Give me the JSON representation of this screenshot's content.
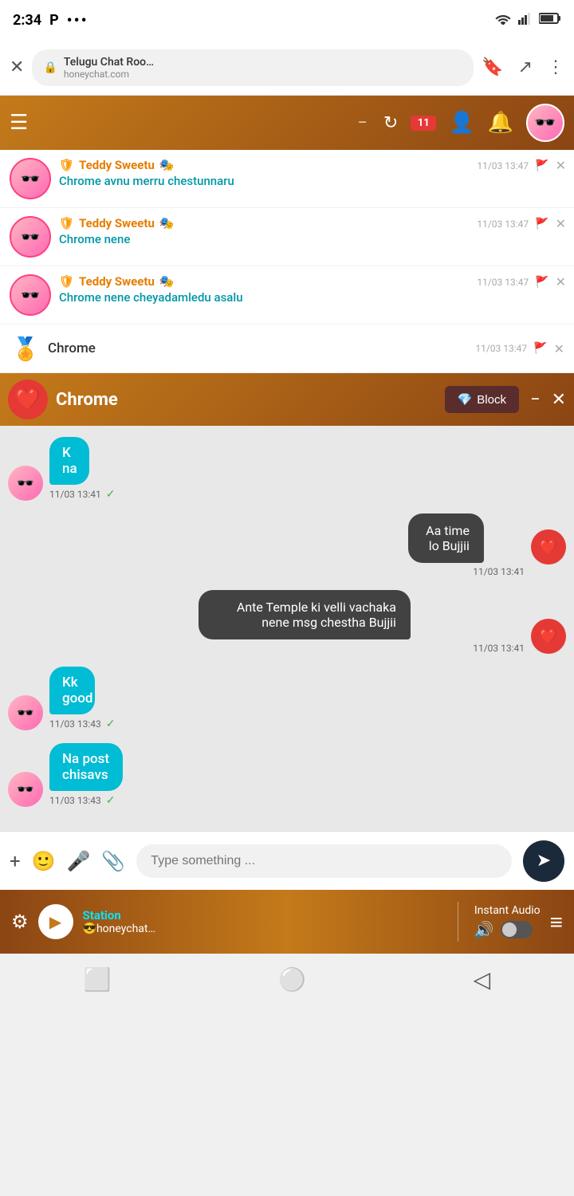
{
  "status": {
    "time": "2:34",
    "carrier_icon": "P",
    "dots": "•••",
    "wifi": "WiFi",
    "signal": "Signal",
    "battery": "Battery"
  },
  "browser": {
    "close_label": "✕",
    "lock_icon": "🔒",
    "url_title": "Telugu Chat Roo…",
    "url_domain": "honeychat.com",
    "bookmark_icon": "🔖",
    "share_icon": "↗",
    "more_icon": "⋮"
  },
  "header": {
    "menu_icon": "☰",
    "minus_icon": "−",
    "refresh_icon": "↻",
    "badge_count": "11",
    "user_icon": "👤",
    "bell_icon": "🔔"
  },
  "chat_messages": [
    {
      "name": "Teddy Sweetu",
      "name_suffix": "🎭",
      "text": "Chrome avnu merru chestunnaru",
      "time": "11/03 13:47",
      "has_shield": true
    },
    {
      "name": "Teddy Sweetu",
      "name_suffix": "🎭",
      "text": "Chrome nene",
      "time": "11/03 13:47",
      "has_shield": true
    },
    {
      "name": "Teddy Sweetu",
      "name_suffix": "🎭",
      "text": "Chrome nene cheyadamledu asalu",
      "time": "11/03 13:47",
      "has_shield": true
    }
  ],
  "chrome_row": {
    "badge": "🏅",
    "name": "Chrome",
    "time": "11/03 13:47"
  },
  "popup": {
    "avatar_emoji": "❤️",
    "name": "Chrome",
    "block_icon": "💎",
    "block_label": "Block",
    "minus": "−",
    "close": "✕"
  },
  "conversation": [
    {
      "type": "incoming",
      "text": "K na",
      "time": "11/03 13:41",
      "has_check": true
    },
    {
      "type": "outgoing",
      "text": "Aa time lo Bujjii",
      "time": "11/03 13:41"
    },
    {
      "type": "outgoing",
      "text": "Ante Temple ki velli vachaka nene msg chestha Bujjii",
      "time": "11/03 13:41"
    },
    {
      "type": "incoming",
      "text": "Kk good",
      "time": "11/03 13:43",
      "has_check": true
    },
    {
      "type": "incoming",
      "text": "Na post chisavs",
      "time": "11/03 13:43",
      "has_check": true
    }
  ],
  "input_bar": {
    "plus_icon": "+",
    "emoji_icon": "🙂",
    "mic_icon": "🎤",
    "attach_icon": "📎",
    "placeholder": "Type something ...",
    "send_icon": "➤"
  },
  "media_bar": {
    "settings_icon": "⚙",
    "play_icon": "▶",
    "station": "Station",
    "sub": "😎honeychat…",
    "instant_audio_label": "Instant Audio",
    "volume_icon": "🔊",
    "toggle_state": "off",
    "menu_icon": "≡"
  },
  "nav_bar": {
    "square_icon": "⬜",
    "circle_icon": "⚪",
    "back_icon": "◁"
  }
}
